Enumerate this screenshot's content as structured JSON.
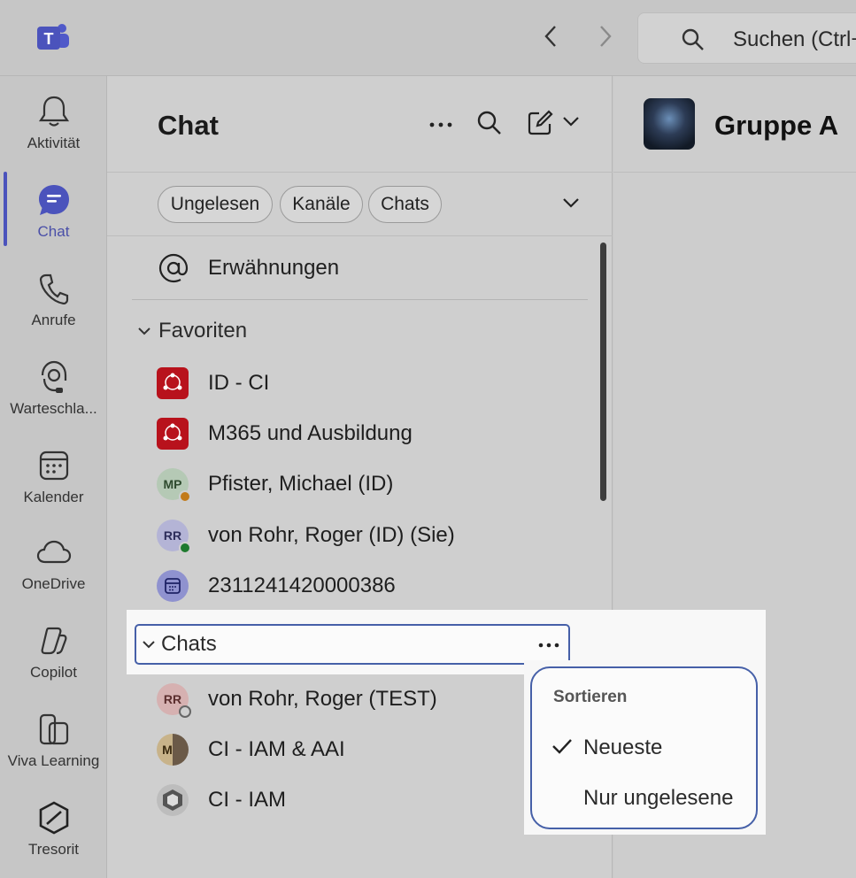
{
  "titlebar": {
    "search_placeholder": "Suchen (Ctrl+"
  },
  "rail": {
    "items": [
      {
        "label": "Aktivität",
        "icon": "bell-icon"
      },
      {
        "label": "Chat",
        "icon": "chat-icon"
      },
      {
        "label": "Anrufe",
        "icon": "phone-icon"
      },
      {
        "label": "Warteschla...",
        "icon": "headset-icon"
      },
      {
        "label": "Kalender",
        "icon": "calendar-icon"
      },
      {
        "label": "OneDrive",
        "icon": "cloud-icon"
      },
      {
        "label": "Copilot",
        "icon": "copilot-icon"
      },
      {
        "label": "Viva Learning",
        "icon": "book-icon"
      },
      {
        "label": "Tresorit",
        "icon": "hexagon-icon"
      }
    ],
    "active_color": "#4b53bc"
  },
  "chatpane": {
    "title": "Chat",
    "filters": [
      "Ungelesen",
      "Kanäle",
      "Chats"
    ],
    "mentions_label": "Erwähnungen",
    "favorites_label": "Favoriten",
    "favorites": [
      {
        "name": "ID - CI",
        "avatar_type": "team-red"
      },
      {
        "name": "M365 und Ausbildung",
        "avatar_type": "team-red"
      },
      {
        "name": "Pfister, Michael (ID)",
        "initials": "MP",
        "presence": "away"
      },
      {
        "name": "von Rohr, Roger (ID) (Sie)",
        "initials": "RR",
        "presence": "available"
      },
      {
        "name": "2311241420000386",
        "avatar_type": "meeting"
      }
    ],
    "chats_label": "Chats",
    "chats": [
      {
        "name": "von Rohr, Roger (TEST)",
        "initials": "RR",
        "presence": "offline"
      },
      {
        "name": "CI - IAM & AAI",
        "initials": "M",
        "avatar_type": "group"
      },
      {
        "name": "CI - IAM",
        "avatar_type": "logo"
      }
    ]
  },
  "conversation": {
    "title": "Gruppe A"
  },
  "sort_menu": {
    "title": "Sortieren",
    "options": [
      "Neueste",
      "Nur ungelesene"
    ],
    "selected": "Neueste"
  }
}
